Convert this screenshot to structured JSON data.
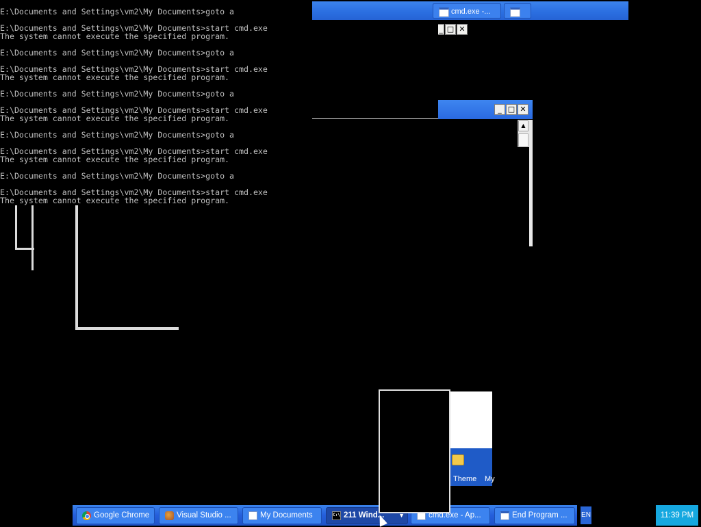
{
  "console": {
    "lines": [
      "E:\\Documents and Settings\\vm2\\My Documents>goto a",
      "",
      "E:\\Documents and Settings\\vm2\\My Documents>start cmd.exe",
      "The system cannot execute the specified program.",
      "",
      "E:\\Documents and Settings\\vm2\\My Documents>goto a",
      "",
      "E:\\Documents and Settings\\vm2\\My Documents>start cmd.exe",
      "The system cannot execute the specified program.",
      "",
      "E:\\Documents and Settings\\vm2\\My Documents>goto a",
      "",
      "E:\\Documents and Settings\\vm2\\My Documents>start cmd.exe",
      "The system cannot execute the specified program.",
      "",
      "E:\\Documents and Settings\\vm2\\My Documents>goto a",
      "",
      "E:\\Documents and Settings\\vm2\\My Documents>start cmd.exe",
      "The system cannot execute the specified program.",
      "",
      "E:\\Documents and Settings\\vm2\\My Documents>goto a",
      "",
      "E:\\Documents and Settings\\vm2\\My Documents>start cmd.exe",
      "The system cannot execute the specified program."
    ]
  },
  "top_bar": {
    "button_label": "cmd.exe -..."
  },
  "window_controls": {
    "minimize": "_",
    "maximize": "□",
    "close": "✕"
  },
  "desktop": {
    "theme_label": "Theme",
    "my_label": "My"
  },
  "taskbar": {
    "items": [
      {
        "label": "Google Chrome",
        "icon": "chrome-icon"
      },
      {
        "label": "Visual Studio ...",
        "icon": "visual-studio-icon"
      },
      {
        "label": "My Documents",
        "icon": "folder-doc-icon"
      },
      {
        "label": "211 Wind...",
        "icon": "cmd-icon"
      },
      {
        "label": "cmd.exe - Ap...",
        "icon": "app-window-icon"
      },
      {
        "label": "End Program ...",
        "icon": "app-window-icon"
      }
    ],
    "language": "EN",
    "clock": "11:39 PM"
  },
  "colors": {
    "taskbar_blue": "#245edb",
    "clock_bg": "#16a8e0",
    "console_text": "#c0c0c0"
  }
}
